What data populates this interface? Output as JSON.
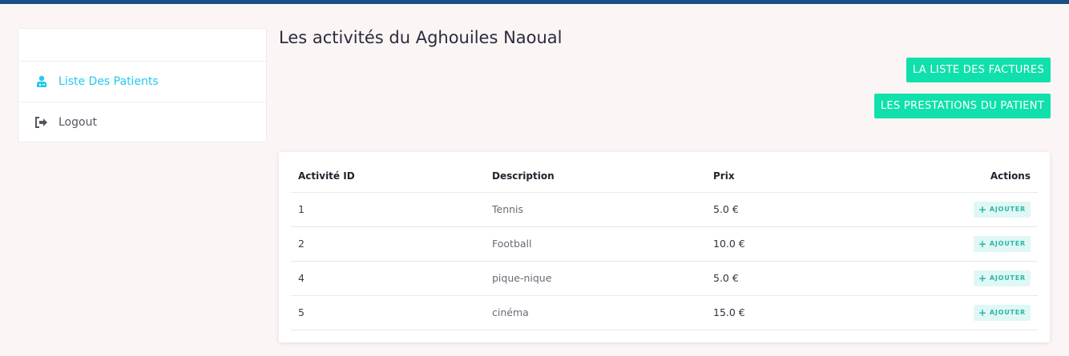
{
  "sidebar": {
    "items": [
      {
        "label": "Liste Des Patients",
        "icon": "doctor-icon"
      },
      {
        "label": "Logout",
        "icon": "logout-icon"
      }
    ]
  },
  "page": {
    "title": "Les activités du Aghouiles Naoual"
  },
  "buttons": {
    "factures": "LA LISTE DES FACTURES",
    "prestations": "LES PRESTATIONS DU PATIENT"
  },
  "table": {
    "headers": [
      "Activité ID",
      "Description",
      "Prix",
      "Actions"
    ],
    "rows": [
      {
        "id": "1",
        "description": "Tennis",
        "prix": "5.0 €",
        "action": "AJOUTER"
      },
      {
        "id": "2",
        "description": "Football",
        "prix": "10.0 €",
        "action": "AJOUTER"
      },
      {
        "id": "4",
        "description": "pique-nique",
        "prix": "5.0 €",
        "action": "AJOUTER"
      },
      {
        "id": "5",
        "description": "cinéma",
        "prix": "15.0 €",
        "action": "AJOUTER"
      }
    ]
  },
  "colors": {
    "topbar": "#1a4f85",
    "accent_green": "#10e0ab",
    "active_link": "#22c9f0",
    "background": "#fcf5f5"
  }
}
